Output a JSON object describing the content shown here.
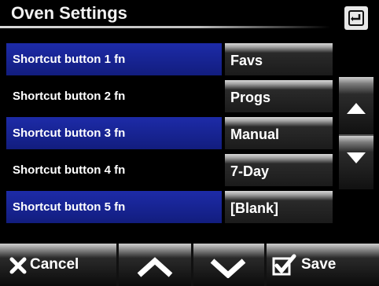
{
  "header": {
    "title": "Oven Settings",
    "back_icon": "back-return-icon"
  },
  "settings": [
    {
      "label": "Shortcut button 1 fn",
      "value": "Favs",
      "highlighted": true
    },
    {
      "label": "Shortcut button 2 fn",
      "value": "Progs",
      "highlighted": false
    },
    {
      "label": "Shortcut button 3 fn",
      "value": "Manual",
      "highlighted": true
    },
    {
      "label": "Shortcut button 4 fn",
      "value": "7-Day",
      "highlighted": false
    },
    {
      "label": "Shortcut button 5 fn",
      "value": "[Blank]",
      "highlighted": true
    }
  ],
  "scroll": {
    "up_icon": "triangle-up-icon",
    "down_icon": "triangle-down-icon"
  },
  "footer": {
    "cancel_label": "Cancel",
    "cancel_icon": "x-icon",
    "up_icon": "chevron-up-icon",
    "down_icon": "chevron-down-icon",
    "save_label": "Save",
    "save_icon": "checkbox-check-icon"
  },
  "colors": {
    "background": "#000000",
    "highlight": "#1d2ba8",
    "text": "#ffffff"
  }
}
